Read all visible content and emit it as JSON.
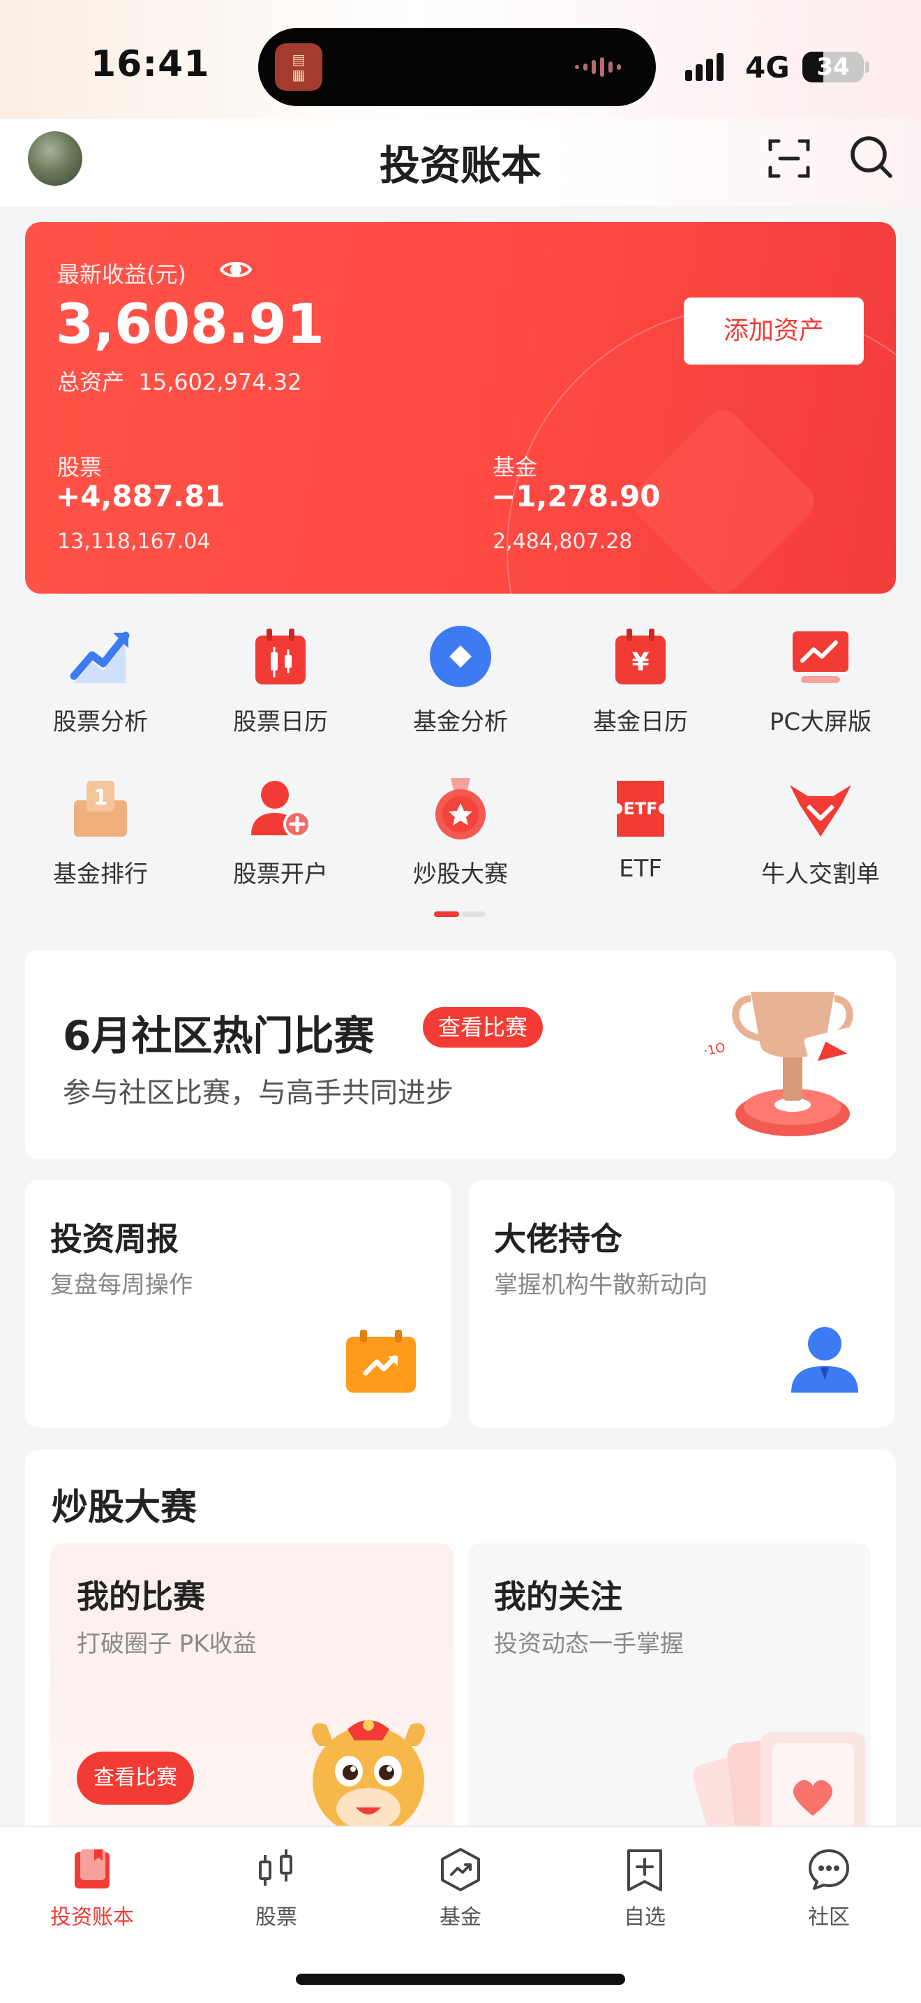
{
  "status_bar": {
    "time": "16:41",
    "network": "4G",
    "battery": "34"
  },
  "header": {
    "title": "投资账本"
  },
  "asset_card": {
    "latest_label": "最新收益(元)",
    "latest_value": "3,608.91",
    "total_label": "总资产",
    "total_value": "15,602,974.32",
    "add_button": "添加资产",
    "stock": {
      "label": "股票",
      "profit": "+4,887.81",
      "total": "13,118,167.04"
    },
    "fund": {
      "label": "基金",
      "profit": "−1,278.90",
      "total": "2,484,807.28"
    }
  },
  "grid": [
    {
      "label": "股票分析",
      "icon": "chart-up-icon"
    },
    {
      "label": "股票日历",
      "icon": "candlestick-calendar-icon"
    },
    {
      "label": "基金分析",
      "icon": "diamond-circle-icon"
    },
    {
      "label": "基金日历",
      "icon": "yuan-calendar-icon"
    },
    {
      "label": "PC大屏版",
      "icon": "monitor-icon"
    },
    {
      "label": "基金排行",
      "icon": "ranking-icon"
    },
    {
      "label": "股票开户",
      "icon": "add-user-icon"
    },
    {
      "label": "炒股大赛",
      "icon": "medal-icon"
    },
    {
      "label": "ETF",
      "icon": "etf-ticket-icon"
    },
    {
      "label": "牛人交割单",
      "icon": "bull-icon"
    }
  ],
  "banner": {
    "title": "6月社区热门比赛",
    "button": "查看比赛",
    "subtitle": "参与社区比赛，与高手共同进步"
  },
  "weekly_card": {
    "title": "投资周报",
    "subtitle": "复盘每周操作"
  },
  "holdings_card": {
    "title": "大佬持仓",
    "subtitle": "掌握机构牛散新动向"
  },
  "contest": {
    "title": "炒股大赛",
    "my_contest": {
      "title": "我的比赛",
      "subtitle": "打破圈子 PK收益",
      "button": "查看比赛"
    },
    "my_follow": {
      "title": "我的关注",
      "subtitle": "投资动态一手掌握"
    }
  },
  "tabbar": [
    {
      "label": "投资账本",
      "active": true
    },
    {
      "label": "股票",
      "active": false
    },
    {
      "label": "基金",
      "active": false
    },
    {
      "label": "自选",
      "active": false
    },
    {
      "label": "社区",
      "active": false
    }
  ],
  "colors": {
    "accent": "#f23b34",
    "blue": "#3d7bf2",
    "orange": "#ff9a1a"
  }
}
